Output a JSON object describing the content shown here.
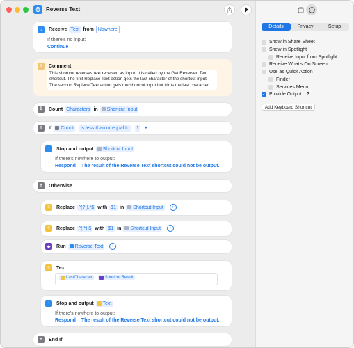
{
  "window": {
    "title": "Reverse Text"
  },
  "actions": {
    "receive": {
      "label": "Receive",
      "type": "Text",
      "from": "from",
      "source": "Nowhere",
      "if_none": "If there's no input:",
      "if_none_action": "Continue"
    },
    "comment": {
      "label": "Comment",
      "text": "This shortcut reverses text received as input. It is called by the Get Reversed Text shortcut. The first Replace Text action gets the last character of the shortcut input. The second Replace Text action gets the shortcut input but trims the last character."
    },
    "count": {
      "label": "Count",
      "what": "Characters",
      "in": "in",
      "var": "Shortcut Input"
    },
    "if": {
      "label": "If",
      "var": "Count",
      "cond": "is less than or equal to",
      "value": "1",
      "plus": "+"
    },
    "stop1": {
      "label": "Stop and output",
      "var": "Shortcut Input",
      "nowhere": "If there's nowhere to output:",
      "respond": "Respond",
      "msg": "The result of the Reverse Text shortcut could not be output."
    },
    "otherwise": {
      "label": "Otherwise"
    },
    "replace1": {
      "label": "Replace",
      "pattern": "^(?.).*$",
      "with": "with",
      "rep": "$1",
      "in": "in",
      "var": "Shortcut Input"
    },
    "replace2": {
      "label": "Replace",
      "pattern": "^(.*).$",
      "with": "with",
      "rep": "$1",
      "in": "in",
      "var": "Shortcut Input"
    },
    "run": {
      "label": "Run",
      "target": "Reverse Text"
    },
    "text": {
      "label": "Text",
      "var1": "LastCharacter",
      "var2": "Shortcut Result"
    },
    "stop2": {
      "label": "Stop and output",
      "var": "Text",
      "nowhere": "If there's nowhere to output:",
      "respond": "Respond",
      "msg": "The result of the Reverse Text shortcut could not be output."
    },
    "endif": {
      "label": "End If"
    }
  },
  "sidebar": {
    "tabs": [
      "Details",
      "Privacy",
      "Setup"
    ],
    "options": [
      {
        "label": "Show in Share Sheet",
        "checked": false
      },
      {
        "label": "Show in Spotlight",
        "checked": false
      },
      {
        "label": "Receive Input from Spotlight",
        "checked": false
      },
      {
        "label": "Receive What's On Screen",
        "checked": false
      },
      {
        "label": "Use as Quick Action",
        "checked": false
      },
      {
        "label": "Finder",
        "checked": false
      },
      {
        "label": "Services Menu",
        "checked": false
      },
      {
        "label": "Provide Output",
        "checked": true
      }
    ],
    "help": "?",
    "keyboard_button": "Add Keyboard Shortcut"
  },
  "colors": {
    "accent": "#1e77e5",
    "comment_bg": "#fff5e6"
  }
}
